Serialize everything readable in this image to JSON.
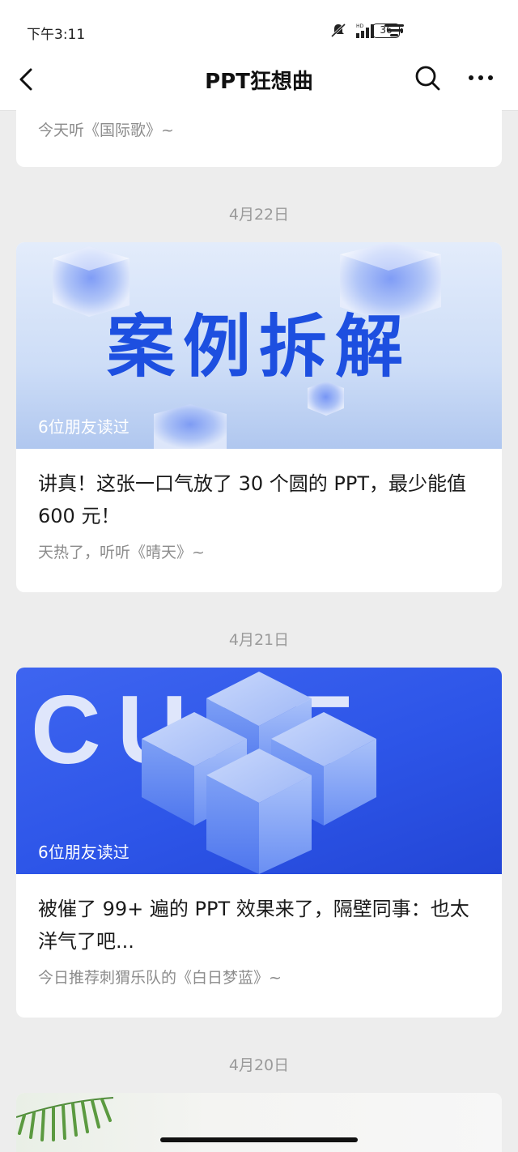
{
  "status_bar": {
    "time": "下午3:11",
    "battery": "36",
    "hd_label": "HD"
  },
  "nav": {
    "title": "PPT狂想曲"
  },
  "feed": {
    "prev_card": {
      "subtitle": "今天听《国际歌》~"
    },
    "groups": [
      {
        "date": "4月22日",
        "cover_text": "案例拆解",
        "friends_read": "6位朋友读过",
        "title": "讲真！这张一口气放了 30 个圆的 PPT，最少能值 600 元！",
        "subtitle": "天热了，听听《晴天》~"
      },
      {
        "date": "4月21日",
        "cover_text": "CUBE",
        "friends_read": "6位朋友读过",
        "title": "被催了 99+ 遍的 PPT 效果来了，隔壁同事：也太洋气了吧...",
        "subtitle": "今日推荐刺猬乐队的《白日梦蓝》~"
      },
      {
        "date": "4月20日"
      }
    ]
  },
  "colors": {
    "accent_blue": "#1d4fe0",
    "bg": "#ededed",
    "muted": "#8c8c8c"
  }
}
